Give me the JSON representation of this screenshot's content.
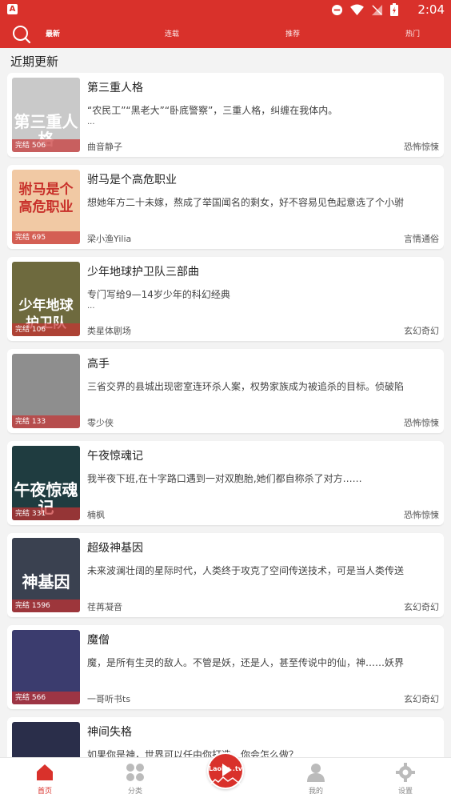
{
  "status_bar": {
    "time": "2:04",
    "app_letter": "A"
  },
  "topbar": {
    "tabs": [
      {
        "label": "最新",
        "active": true
      },
      {
        "label": "连载",
        "active": false
      },
      {
        "label": "推荐",
        "active": false
      },
      {
        "label": "热门",
        "active": false
      }
    ]
  },
  "section_title": "近期更新",
  "books": [
    {
      "title": "第三重人格",
      "desc": "“农民工”“黑老大”“卧底警察”，三重人格，纠缠在我体内。",
      "more": "...",
      "author": "曲音静子",
      "genre": "恐怖惊悚",
      "status": "完结 506",
      "cover_text": "第三重人格",
      "cover_bg": "#c9c9c9"
    },
    {
      "title": "驸马是个高危职业",
      "desc": "想她年方二十未嫁，熬成了举国闻名的剩女，好不容易见色起意选了个小驸",
      "more": "",
      "author": "梁小渔Yilia",
      "genre": "言情通俗",
      "status": "完结 695",
      "cover_text": "驸马是个高危职业",
      "cover_bg": "#f1c9a4"
    },
    {
      "title": "少年地球护卫队三部曲",
      "desc": "专门写给9—14岁少年的科幻经典",
      "more": "...",
      "author": "类星体剧场",
      "genre": "玄幻奇幻",
      "status": "完结 106",
      "cover_text": "少年地球护卫队",
      "cover_bg": "#6e6a3e"
    },
    {
      "title": "高手",
      "desc": "三省交界的县城出现密室连环杀人案，权势家族成为被追杀的目标。侦破陷",
      "more": "",
      "author": "零少侠",
      "genre": "恐怖惊悚",
      "status": "完结 133",
      "cover_text": "",
      "cover_bg": "#8e8e8e"
    },
    {
      "title": "午夜惊魂记",
      "desc": "我半夜下班,在十字路口遇到一对双胞胎,她们都自称杀了对方……",
      "more": "",
      "author": "楠枫",
      "genre": "恐怖惊悚",
      "status": "完结 331",
      "cover_text": "午夜惊魂记",
      "cover_bg": "#1f3c40"
    },
    {
      "title": "超级神基因",
      "desc": "未来波澜壮阔的星际时代，人类终于攻克了空间传送技术，可是当人类传送",
      "more": "",
      "author": "荏苒凝音",
      "genre": "玄幻奇幻",
      "status": "完结 1596",
      "cover_text": "神基因",
      "cover_bg": "#3a4150"
    },
    {
      "title": "魔僧",
      "desc": "魔，是所有生灵的敌人。不管是妖，还是人，甚至传说中的仙，神……妖界",
      "more": "",
      "author": "一哥听书ts",
      "genre": "玄幻奇幻",
      "status": "完结 566",
      "cover_text": "",
      "cover_bg": "#3b3c6e"
    },
    {
      "title": "神间失格",
      "desc": "如果你是神，世界可以任由你打造，你会怎么做？",
      "more": "",
      "author": "",
      "genre": "",
      "status": "",
      "cover_text": "",
      "cover_bg": "#2a2e4a"
    }
  ],
  "bottom_nav": {
    "items": [
      {
        "label": "首页",
        "icon": "home-icon",
        "active": true
      },
      {
        "label": "分类",
        "icon": "category-grid-icon",
        "active": false
      },
      {
        "label": "我的",
        "icon": "person-icon",
        "active": false
      },
      {
        "label": "设置",
        "icon": "gear-icon",
        "active": false
      }
    ],
    "center_logo_text": "Laoba .tv"
  },
  "colors": {
    "brand_red": "#d9312b"
  }
}
